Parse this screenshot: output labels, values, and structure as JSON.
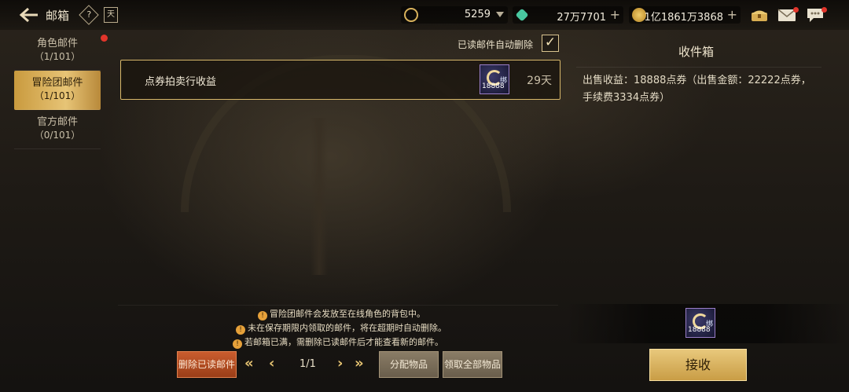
{
  "header": {
    "title": "邮箱",
    "help_label": "?",
    "calendar_label": "天"
  },
  "resources": [
    {
      "name": "point-coupon",
      "value": "5259",
      "icon": "coupon-icon",
      "color": "#d9b25c"
    },
    {
      "name": "crystal",
      "value": "27万7701",
      "icon": "crystal-icon",
      "color": "#49c7a0"
    },
    {
      "name": "gold",
      "value": "1亿1861万3868",
      "icon": "gold-coin-icon",
      "color": "#d7a53c"
    }
  ],
  "sidebar": {
    "items": [
      {
        "label": "角色邮件",
        "count": "（1/101）",
        "active": false
      },
      {
        "label": "冒险团邮件",
        "count": "（1/101）",
        "active": true
      },
      {
        "label": "官方邮件",
        "count": "（0/101）",
        "active": false
      }
    ]
  },
  "mail_list": {
    "auto_delete_label": "已读邮件自动删除",
    "auto_delete_checked": true,
    "items": [
      {
        "title": "点券拍卖行收益",
        "item_count": "18888",
        "bound_label": "绑",
        "days_left": "29天"
      }
    ]
  },
  "detail": {
    "title": "收件箱",
    "body": "出售收益：18888点券（出售金额：22222点券，手续费3334点券）",
    "attachment_count": "18888",
    "attachment_bound": "绑",
    "receive_label": "接收"
  },
  "notes": [
    "冒险团邮件会发放至在线角色的背包中。",
    "未在保存期限内领取的邮件，将在超期时自动删除。",
    "若邮箱已满，需删除已读邮件后才能查看新的邮件。"
  ],
  "footer": {
    "delete_read_label": "删除已读邮件",
    "page": "1/1",
    "distribute_label": "分配物品",
    "claim_all_label": "领取全部物品"
  }
}
